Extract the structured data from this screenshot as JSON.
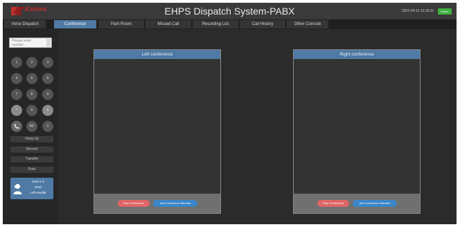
{
  "header": {
    "logo_text": "Kalima",
    "title": "EHPS Dispatch System-PABX",
    "datetime": "2021-04-13 15:18:31",
    "status": "Online"
  },
  "tabs": [
    {
      "label": "Voice Dispatch",
      "active": false
    },
    {
      "label": "Conference",
      "active": true
    },
    {
      "label": "Park Room",
      "active": false
    },
    {
      "label": "Missed Call",
      "active": false
    },
    {
      "label": "Recording List",
      "active": false
    },
    {
      "label": "Call History",
      "active": false
    },
    {
      "label": "Other Console",
      "active": false
    }
  ],
  "sidebar": {
    "input_placeholder_line1": "Please enter",
    "input_placeholder_line2": "number",
    "keys": [
      "1",
      "2",
      "3",
      "4",
      "5",
      "6",
      "7",
      "8",
      "9",
      "*",
      "0",
      "#",
      "",
      "RD",
      "C"
    ],
    "buttons": {
      "hang_up": "Hang Up",
      "record": "Record",
      "transfer": "Transfer",
      "park": "Park"
    },
    "user": {
      "name": "Cent-4 IL",
      "extension": "2010",
      "mode": "Left Handle"
    }
  },
  "panels": {
    "left": {
      "title": "Left conference",
      "stop_label": "Stop Conference",
      "add_label": "Add Conference Member"
    },
    "right": {
      "title": "Right conference",
      "stop_label": "Stop Conference",
      "add_label": "Add Conference Member"
    }
  },
  "colors": {
    "accent": "#4f7aa5",
    "online": "#3fae3f",
    "stop": "#e06666",
    "add": "#3b86c8",
    "logo": "#c0302c"
  }
}
